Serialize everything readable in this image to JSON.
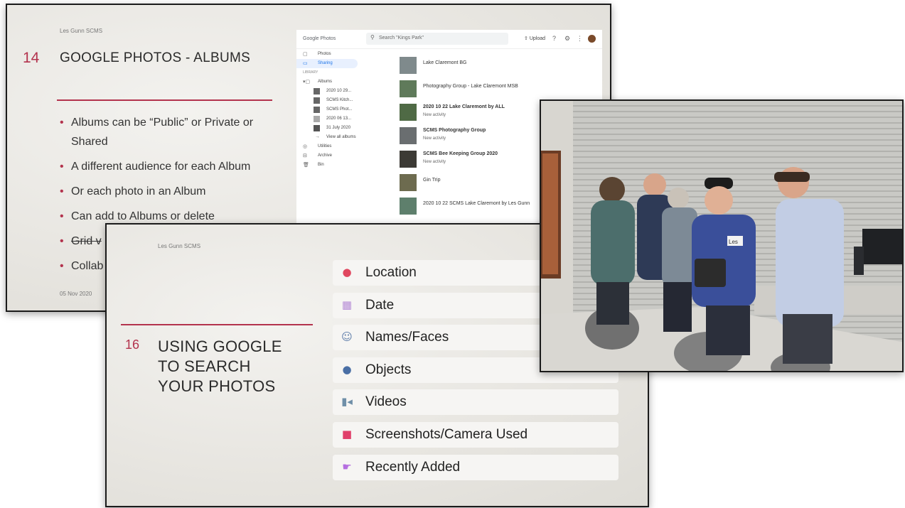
{
  "slide14": {
    "author": "Les Gunn SCMS",
    "number": "14",
    "title": "GOOGLE PHOTOS - ALBUMS",
    "bullets": [
      "Albums can be “Public” or Private or Shared",
      "A different audience for each Album",
      "Or each photo in an Album",
      "Can add to Albums or delete",
      "Grid v",
      "Collab"
    ],
    "date": "05 Nov 2020",
    "google_photos": {
      "logo": "Google Photos",
      "search_placeholder": "Search \"Kings Park\"",
      "upload_label": "Upload",
      "sidebar": {
        "photos": "Photos",
        "sharing": "Sharing",
        "library_heading": "LIBRARY",
        "albums": "Albums",
        "album_items": [
          "2020 10 29...",
          "SCMS Kitch...",
          "SCMS Phot...",
          "2020 06 13...",
          "31 July 2020"
        ],
        "view_all": "View all albums",
        "utilities": "Utilities",
        "archive": "Archive",
        "bin": "Bin"
      },
      "shared_items": [
        {
          "title": "Lake Claremont BG",
          "sub": ""
        },
        {
          "title": "Photography Group - Lake Claremont MSB",
          "sub": ""
        },
        {
          "title": "2020 10 22 Lake Claremont by ALL",
          "sub": "New activity"
        },
        {
          "title": "SCMS Photography Group",
          "sub": "New activity"
        },
        {
          "title": "SCMS Bee Keeping Group 2020",
          "sub": "New activity"
        },
        {
          "title": "Gin Trip",
          "sub": ""
        },
        {
          "title": "2020 10 22 SCMS Lake Claremont by Les Gunn",
          "sub": ""
        }
      ]
    }
  },
  "slide16": {
    "author": "Les Gunn SCMS",
    "number": "16",
    "title_lines": [
      "USING GOOGLE",
      "TO SEARCH",
      "YOUR PHOTOS"
    ],
    "items": [
      {
        "label": "Location",
        "icon": "globe-icon",
        "color": "#e0475f",
        "glyph": "🌏"
      },
      {
        "label": "Date",
        "icon": "calendar-icon",
        "color": "#b58ad6",
        "glyph": "📅"
      },
      {
        "label": "Names/Faces",
        "icon": "smiley-icon",
        "color": "#5a7aa8",
        "glyph": "☺"
      },
      {
        "label": "Objects",
        "icon": "globe-object-icon",
        "color": "#4a6fa5",
        "glyph": "●"
      },
      {
        "label": "Videos",
        "icon": "video-camera-icon",
        "color": "#6f8fa8",
        "glyph": "■"
      },
      {
        "label": "Screenshots/Camera Used",
        "icon": "camera-icon",
        "color": "#e0406a",
        "glyph": "■"
      },
      {
        "label": "Recently Added",
        "icon": "hand-point-icon",
        "color": "#b56ee0",
        "glyph": "☛"
      }
    ]
  },
  "photo": {
    "name_tag": "Les"
  }
}
